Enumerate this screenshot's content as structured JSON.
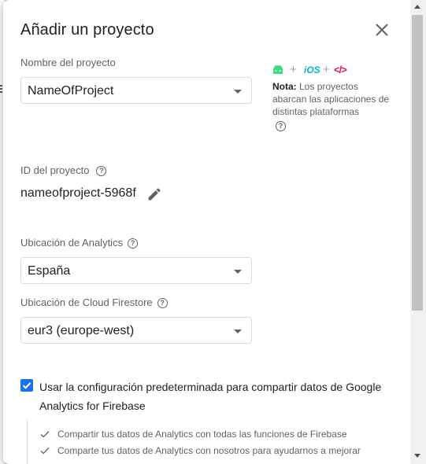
{
  "dialog": {
    "title": "Añadir un proyecto"
  },
  "project_name": {
    "label": "Nombre del proyecto",
    "value": "NameOfProject"
  },
  "platforms": {
    "icons": [
      "android-icon",
      "ios-icon",
      "web-code-icon"
    ],
    "ios_text": "iOS",
    "plus": "+",
    "code_text": "</>",
    "note_label": "Nota:",
    "note_text": " Los proyectos abarcan las aplicaciones de distintas plataformas"
  },
  "project_id": {
    "label": "ID del proyecto",
    "value": "nameofproject-5968f"
  },
  "analytics_location": {
    "label": "Ubicación de Analytics",
    "value": "España"
  },
  "firestore_location": {
    "label": "Ubicación de Cloud Firestore",
    "value": "eur3 (europe-west)"
  },
  "sharing": {
    "checked": true,
    "label": "Usar la configuración predeterminada para compartir datos de Google Analytics for Firebase",
    "items": [
      "Compartir tus datos de Analytics con todas las funciones de Firebase",
      "Comparte tus datos de Analytics con nosotros para ayudarnos a mejorar"
    ]
  },
  "colors": {
    "accent": "#1a73e8",
    "android": "#3ddc84",
    "ios": "#00b8d4",
    "web": "#d81b60"
  }
}
